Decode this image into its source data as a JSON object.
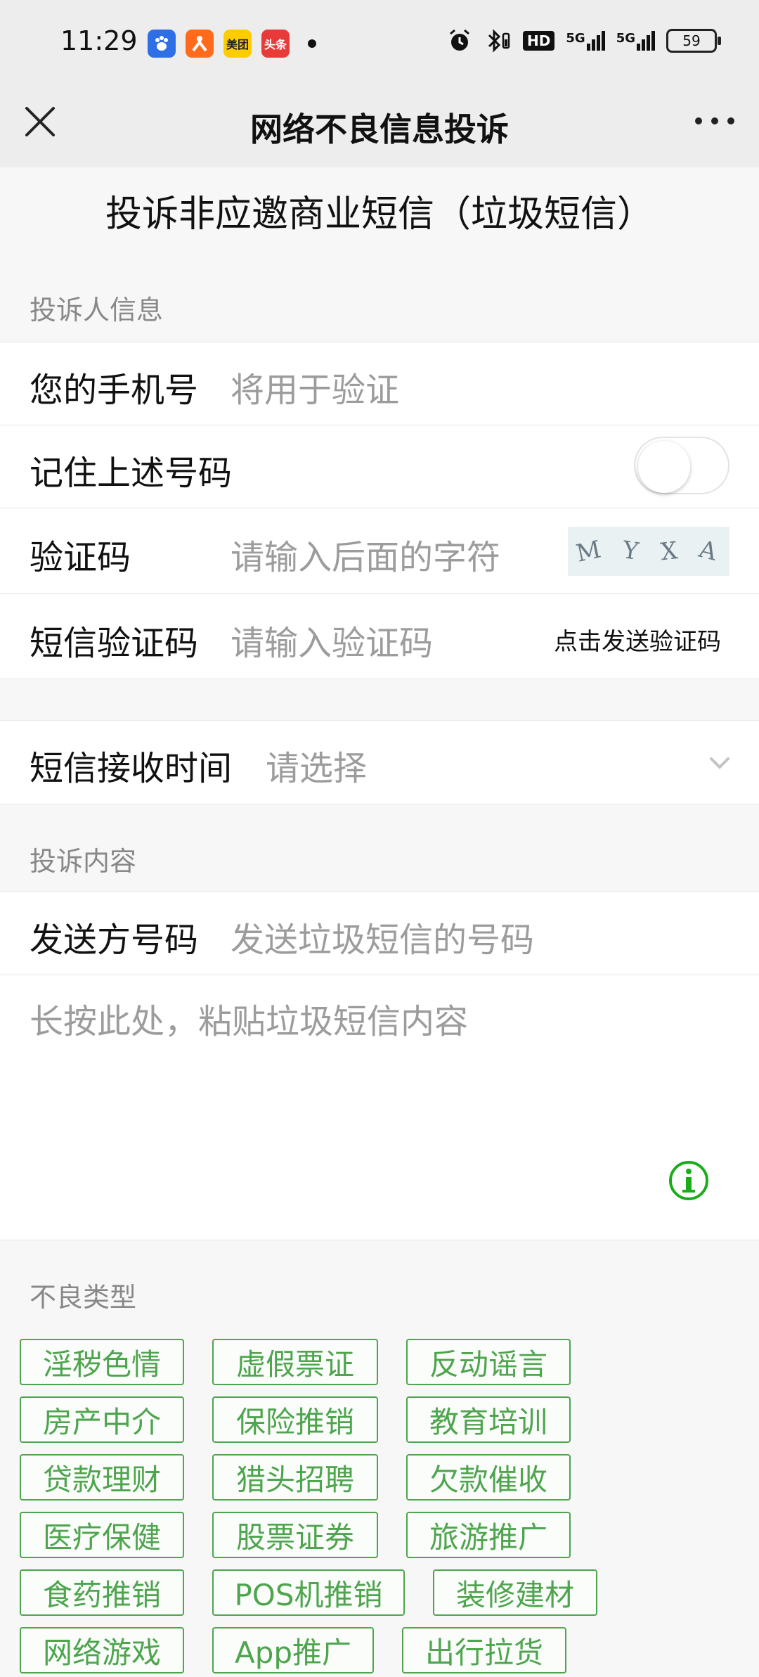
{
  "status_bar": {
    "time": "11:29",
    "apps": [
      {
        "name": "baidu-app-icon",
        "text": "",
        "color": "#2f6fe6"
      },
      {
        "name": "taobao-special-app-icon",
        "text": "",
        "color": "#ff6b1a"
      },
      {
        "name": "meituan-app-icon",
        "text": "美团",
        "color": "#ffcc00"
      },
      {
        "name": "toutiao-app-icon",
        "text": "头条",
        "color": "#e93a3a"
      }
    ],
    "network": "5G",
    "hd_label": "HD",
    "battery": "59"
  },
  "nav": {
    "title": "网络不良信息投诉"
  },
  "page": {
    "title": "投诉非应邀商业短信（垃圾短信）"
  },
  "complainant": {
    "section_label": "投诉人信息",
    "phone_label": "您的手机号",
    "phone_placeholder": "将用于验证",
    "remember_label": "记住上述号码",
    "remember_on": false,
    "captcha_label": "验证码",
    "captcha_placeholder": "请输入后面的字符",
    "captcha_chars": [
      "M",
      "Y",
      "X",
      "A"
    ],
    "sms_code_label": "短信验证码",
    "sms_code_placeholder": "请输入验证码",
    "send_code_link": "点击发送验证码"
  },
  "receive_time": {
    "label": "短信接收时间",
    "placeholder": "请选择"
  },
  "content": {
    "section_label": "投诉内容",
    "sender_label": "发送方号码",
    "sender_placeholder": "发送垃圾短信的号码",
    "message_placeholder": "长按此处，粘贴垃圾短信内容"
  },
  "types": {
    "section_label": "不良类型",
    "tags": [
      "淫秽色情",
      "虚假票证",
      "反动谣言",
      "房产中介",
      "保险推销",
      "教育培训",
      "贷款理财",
      "猎头招聘",
      "欠款催收",
      "医疗保健",
      "股票证券",
      "旅游推广",
      "食药推销",
      "POS机推销",
      "装修建材",
      "网络游戏",
      "App推广",
      "出行拉货"
    ]
  },
  "colors": {
    "accent_green": "#4ea54e",
    "bar_bg": "#ededed",
    "page_bg": "#f7f7f7"
  }
}
